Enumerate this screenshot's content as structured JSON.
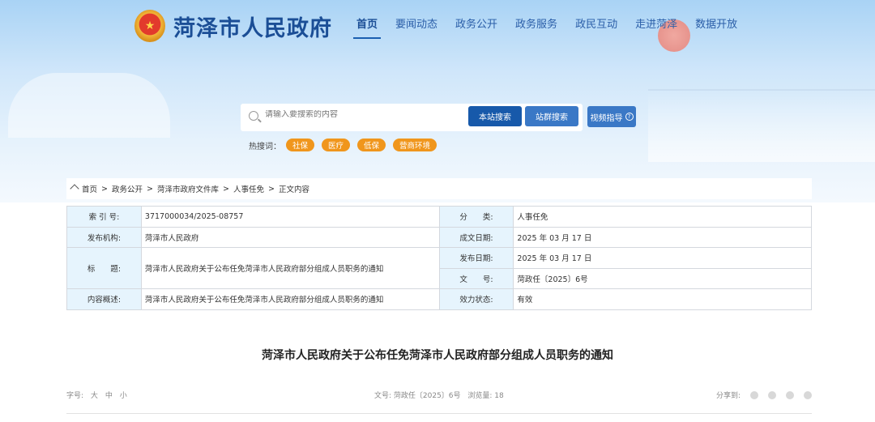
{
  "site": {
    "title": "菏泽市人民政府"
  },
  "nav": [
    "首页",
    "要闻动态",
    "政务公开",
    "政务服务",
    "政民互动",
    "走进菏泽",
    "数据开放"
  ],
  "search": {
    "placeholder": "请输入要搜索的内容",
    "btn_site": "本站搜索",
    "btn_group": "站群搜索",
    "btn_video": "视频指导",
    "help_glyph": "?"
  },
  "hot": {
    "label": "热搜词：",
    "tags": [
      "社保",
      "医疗",
      "低保",
      "营商环境"
    ]
  },
  "breadcrumb": [
    "首页",
    "政务公开",
    "菏泽市政府文件库",
    "人事任免",
    "正文内容"
  ],
  "meta_table": {
    "index_label": "索 引 号:",
    "index": "3717000034/2025-08757",
    "category_label": "分　　类:",
    "category": "人事任免",
    "publisher_label": "发布机构:",
    "publisher": "菏泽市人民政府",
    "written_label": "成文日期:",
    "written": "2025 年 03 月 17 日",
    "title_label": "标　　题:",
    "title": "菏泽市人民政府关于公布任免菏泽市人民政府部分组成人员职务的通知",
    "published_label": "发布日期:",
    "published": "2025 年 03 月 17 日",
    "docno_label": "文　　号:",
    "docno": "菏政任〔2025〕6号",
    "summary_label": "内容概述:",
    "summary": "菏泽市人民政府关于公布任免菏泽市人民政府部分组成人员职务的通知",
    "status_label": "效力状态:",
    "status": "有效"
  },
  "article": {
    "title": "菏泽市人民政府关于公布任免菏泽市人民政府部分组成人员职务的通知"
  },
  "tools": {
    "font_label": "字号:",
    "large": "大",
    "medium": "中",
    "small": "小",
    "docno": "文号: 菏政任〔2025〕6号",
    "views": "浏览量: 18",
    "share_label": "分享到:"
  }
}
